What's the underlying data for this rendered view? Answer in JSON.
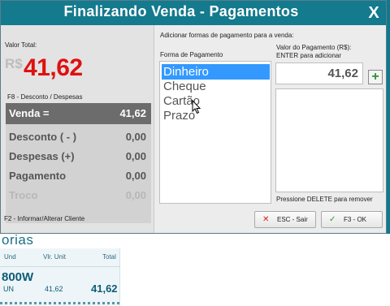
{
  "dialog": {
    "title": "Finalizando Venda - Pagamentos",
    "close_label": "X"
  },
  "summary": {
    "valor_total_label": "Valor Total:",
    "currency": "R$",
    "total": "41,62",
    "f8_hint": "F8 - Desconto / Despesas",
    "rows": [
      {
        "label": "Venda =",
        "value": "41,62"
      },
      {
        "label": "Desconto ( - )",
        "value": "0,00"
      },
      {
        "label": "Despesas (+)",
        "value": "0,00"
      },
      {
        "label": "Pagamento",
        "value": "0,00"
      },
      {
        "label": "Troco",
        "value": "0,00"
      }
    ],
    "f2_hint": "F2 - Informar/Alterar Cliente"
  },
  "payment": {
    "add_label": "Adicionar formas de pagamento para a venda:",
    "forma_label": "Forma de Pagamento",
    "methods": [
      "Dinheiro",
      "Cheque",
      "Cartão",
      "Prazo"
    ],
    "selected_method": "Dinheiro",
    "valor_label_line1": "Valor do Pagamento (R$):",
    "valor_label_line2": "ENTER para adicionar",
    "valor_value": "41,62",
    "add_button": "+",
    "delete_hint": "Pressione DELETE para remover"
  },
  "buttons": {
    "esc_icon": "✕",
    "esc_label": "ESC - Sair",
    "ok_icon": "✓",
    "ok_label": "F3 - OK"
  },
  "background": {
    "section_title": "orias",
    "columns": [
      "Und",
      "Vlr. Unit",
      "Total"
    ],
    "product_name": "800W",
    "unit": "UN",
    "unit_price": "41,62",
    "total": "41,62"
  },
  "colors": {
    "titlebar": "#147a8e",
    "total_red": "#e01010",
    "selected_item": "#3399ff"
  }
}
